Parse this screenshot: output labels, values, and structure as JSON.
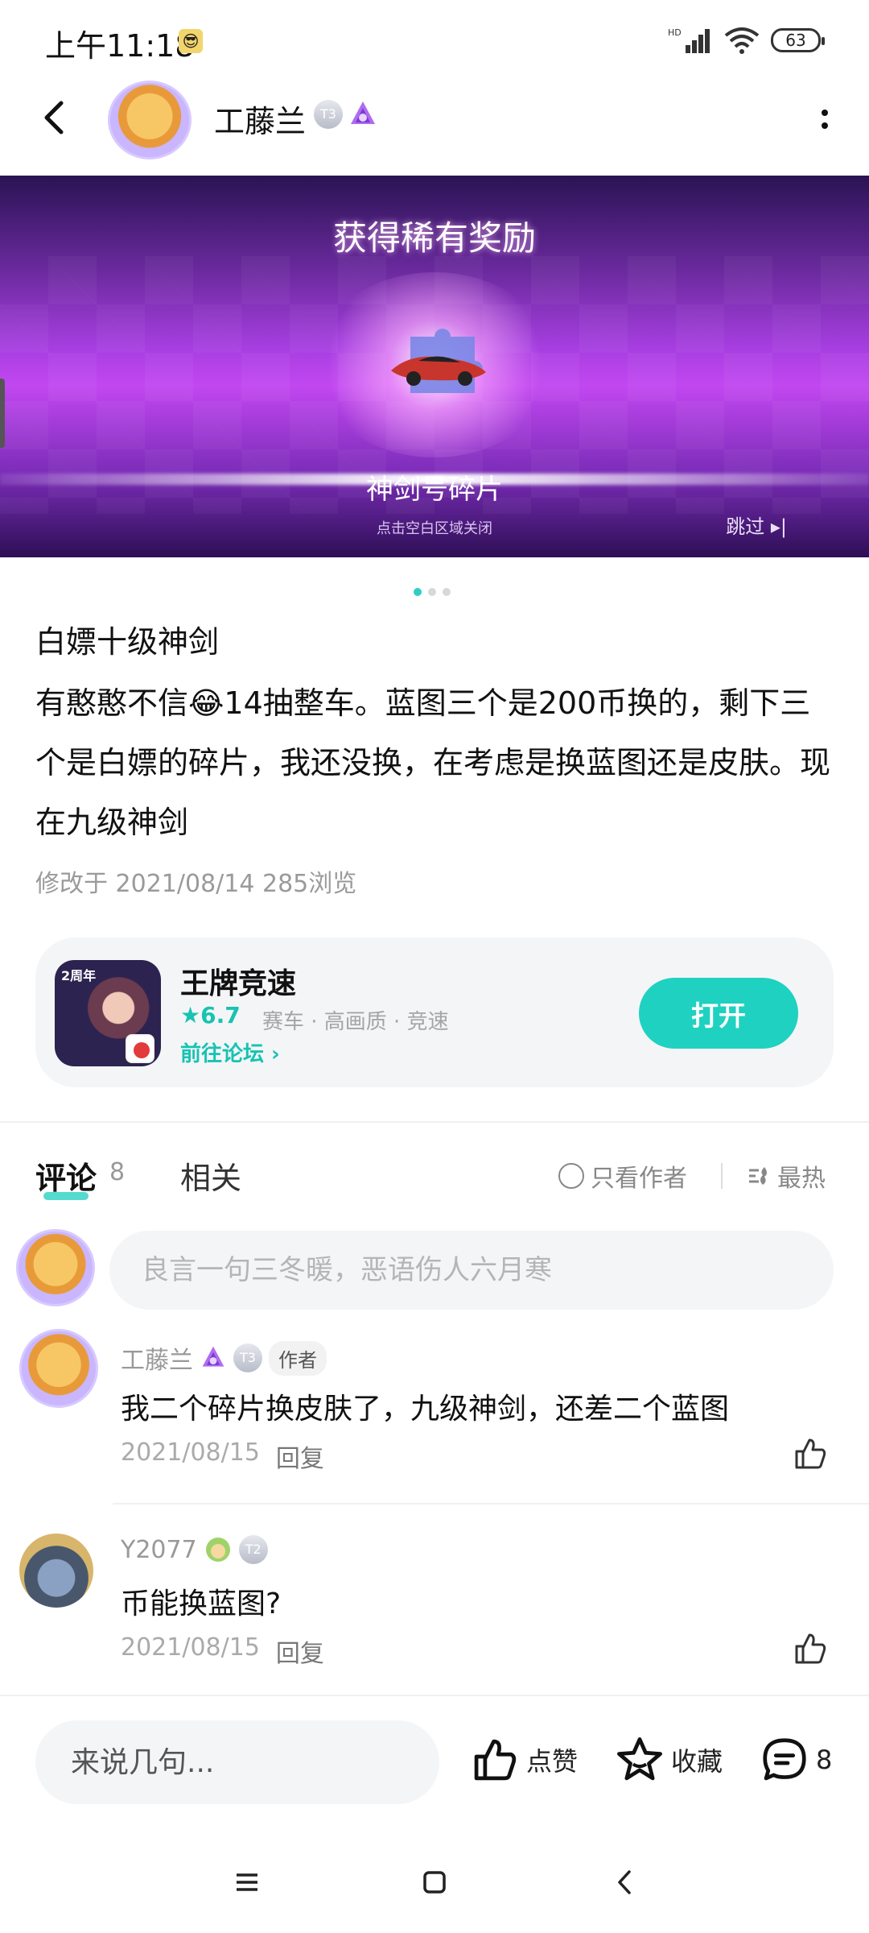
{
  "status_bar": {
    "time": "上午11:18",
    "battery": "63",
    "network": "HD"
  },
  "header": {
    "username": "工藤兰",
    "level_badge": "T3",
    "icons": [
      "back-arrow-icon",
      "more-vertical-icon"
    ]
  },
  "banner": {
    "title": "获得稀有奖励",
    "item_name": "神剑号碎片",
    "hint": "点击空白区域关闭",
    "skip_label": "跳过",
    "page_count": 3,
    "active_page": 1
  },
  "post": {
    "title": "白嫖十级神剑",
    "body": "有憨憨不信😂14抽整车。蓝图三个是200币换的，剩下三个是白嫖的碎片，我还没换，在考虑是换蓝图还是皮肤。现在九级神剑",
    "modified_label": "修改于 2021/08/14",
    "views_label": "285浏览"
  },
  "game_card": {
    "icon_tag": "2周年",
    "name": "王牌竞速",
    "rating": "★6.7",
    "tags": "赛车 · 高画质 · 竞速",
    "forum_link": "前往论坛 ›",
    "open_button": "打开"
  },
  "comments_section": {
    "tab_comment": "评论",
    "comment_count": "8",
    "tab_related": "相关",
    "only_author": "只看作者",
    "sort_label": "最热",
    "input_placeholder": "良言一句三冬暖，恶语伤人六月寒",
    "items": [
      {
        "username": "工藤兰",
        "badge": "T3",
        "author_tag": "作者",
        "text": "我二个碎片换皮肤了，九级神剑，还差二个蓝图",
        "date": "2021/08/15",
        "reply": "回复"
      },
      {
        "username": "Y2077",
        "badge": "T2",
        "text": "币能换蓝图?",
        "date": "2021/08/15",
        "reply": "回复"
      }
    ]
  },
  "bottom_bar": {
    "input_placeholder": "来说几句...",
    "like_label": "点赞",
    "favorite_label": "收藏",
    "comment_count": "8"
  },
  "colors": {
    "accent": "#1fd1c0",
    "meta_gray": "#9a9a9a",
    "card_bg": "#f4f5f7"
  }
}
